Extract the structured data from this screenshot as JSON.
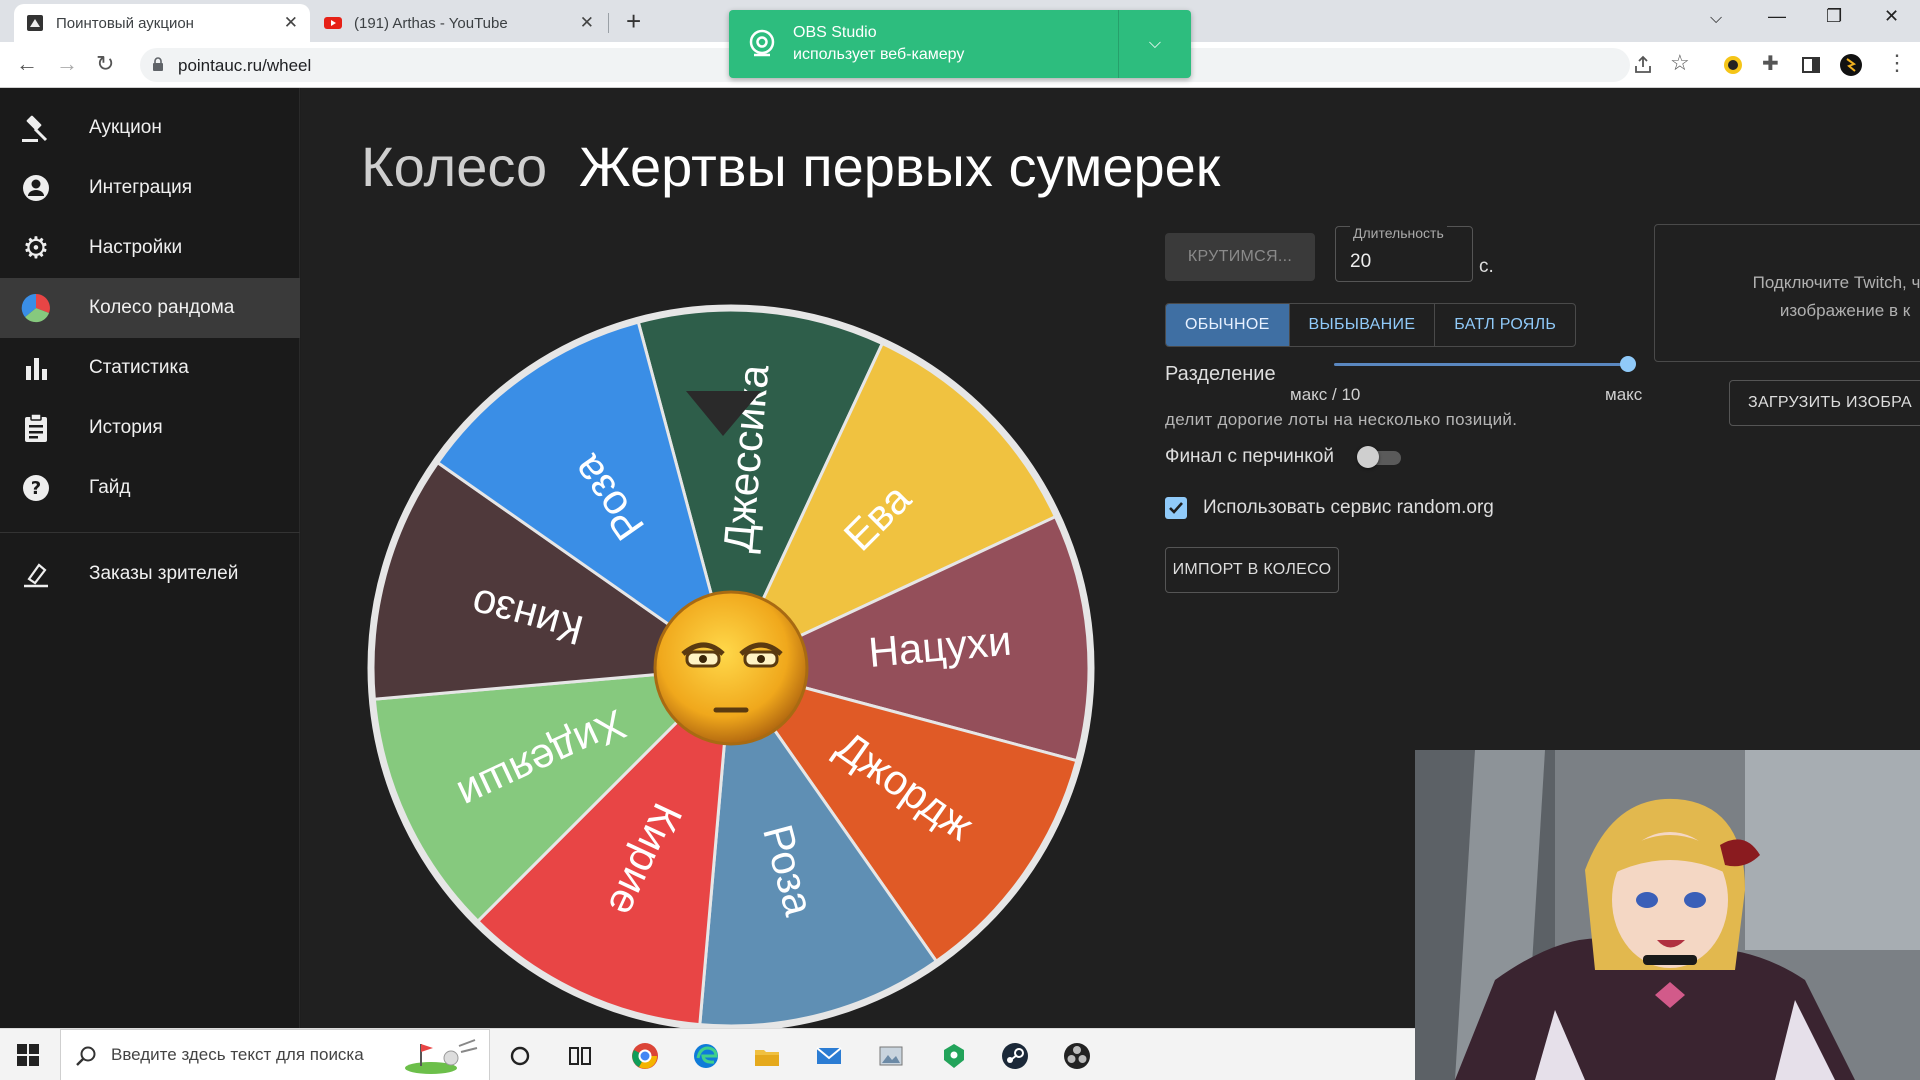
{
  "browser": {
    "tabs": [
      {
        "title": "Поинтовый аукцион",
        "active": true
      },
      {
        "title": "(191) Arthas - YouTube",
        "active": false
      }
    ],
    "url": "pointauc.ru/wheel"
  },
  "obs_notification": {
    "title": "OBS Studio",
    "message": "использует веб-камеру"
  },
  "sidebar": {
    "items": [
      {
        "label": "Аукцион",
        "icon": "gavel-icon"
      },
      {
        "label": "Интеграция",
        "icon": "account-icon"
      },
      {
        "label": "Настройки",
        "icon": "gear-icon"
      },
      {
        "label": "Колесо рандома",
        "icon": "pie-chart-icon",
        "active": true
      },
      {
        "label": "Статистика",
        "icon": "bar-chart-icon"
      },
      {
        "label": "История",
        "icon": "clipboard-icon"
      },
      {
        "label": "Гайд",
        "icon": "help-icon"
      },
      {
        "label": "Заказы зрителей",
        "icon": "viewer-orders-icon"
      }
    ]
  },
  "page": {
    "title_prefix": "Колесо",
    "title_name": "Жертвы первых сумерек"
  },
  "wheel": {
    "segments": [
      {
        "label": "Джессика",
        "color": "#2e5e4a"
      },
      {
        "label": "Ева",
        "color": "#f0c240"
      },
      {
        "label": "Нацухи",
        "color": "#944f5a"
      },
      {
        "label": "Джордж",
        "color": "#e05a26"
      },
      {
        "label": "Роза",
        "color": "#5f8fb4"
      },
      {
        "label": "Кирие",
        "color": "#e84545"
      },
      {
        "label": "Хидеяши",
        "color": "#86c97e"
      },
      {
        "label": "Кинзо",
        "color": "#4f393b"
      },
      {
        "label": "Роза",
        "color": "#3a8ee6"
      }
    ]
  },
  "controls": {
    "spin_label": "КРУТИМСЯ...",
    "duration_label": "Длительность",
    "duration_value": "20",
    "duration_unit": "с.",
    "modes": [
      "ОБЫЧНОЕ",
      "ВЫБЫВАНИЕ",
      "БАТЛ РОЯЛЬ"
    ],
    "active_mode": "ОБЫЧНОЕ",
    "split_label": "Разделение",
    "split_min": "макс / 10",
    "split_max": "макс",
    "split_value_fraction": 1.0,
    "split_hint": "делит дорогие лоты на несколько позиций.",
    "final_label": "Финал с перчинкой",
    "final_enabled": false,
    "random_org_label": "Использовать сервис random.org",
    "random_org_checked": true,
    "import_label": "ИМПОРТ В КОЛЕСО",
    "twitch_line1": "Подключите Twitch, что",
    "twitch_line2": "изображение в к",
    "upload_label": "ЗАГРУЗИТЬ ИЗОБРА"
  },
  "taskbar": {
    "search_placeholder": "Введите здесь текст для поиска"
  },
  "colors": {
    "accent": "#90caf9",
    "active_mode_bg": "#3f6fa3",
    "obs_green": "#2dbd7e"
  }
}
